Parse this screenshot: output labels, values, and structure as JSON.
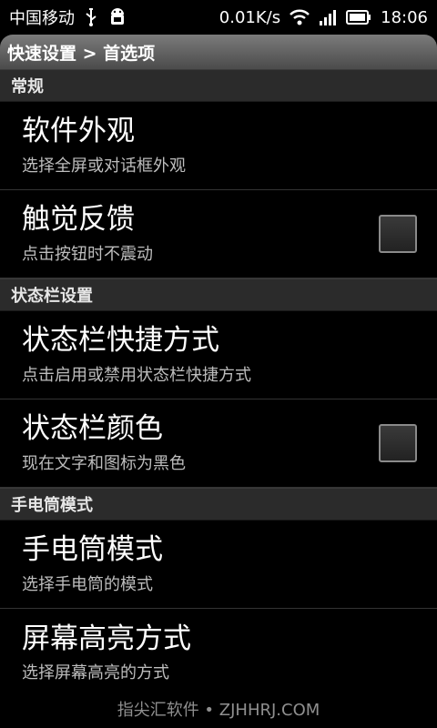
{
  "status_bar": {
    "carrier": "中国移动",
    "speed": "0.01K/s",
    "time": "18:06",
    "icons": [
      "usb-icon",
      "android-icon",
      "wifi-icon",
      "signal-icon",
      "battery-icon"
    ]
  },
  "title_bar": {
    "title": "快速设置 > 首选项"
  },
  "sections": [
    {
      "header": "常规",
      "items": [
        {
          "title": "软件外观",
          "summary": "选择全屏或对话框外观",
          "checkbox": false
        },
        {
          "title": "触觉反馈",
          "summary": "点击按钮时不震动",
          "checkbox": true,
          "checked": false
        }
      ]
    },
    {
      "header": "状态栏设置",
      "items": [
        {
          "title": "状态栏快捷方式",
          "summary": "点击启用或禁用状态栏快捷方式",
          "checkbox": false
        },
        {
          "title": "状态栏颜色",
          "summary": "现在文字和图标为黑色",
          "checkbox": true,
          "checked": false
        }
      ]
    },
    {
      "header": "手电筒模式",
      "items": [
        {
          "title": "手电筒模式",
          "summary": "选择手电筒的模式",
          "checkbox": false
        },
        {
          "title": "屏幕高亮方式",
          "summary": "选择屏幕高亮的方式",
          "checkbox": false
        }
      ]
    }
  ],
  "watermark": "指尖汇软件 • ZJHHRJ.COM"
}
